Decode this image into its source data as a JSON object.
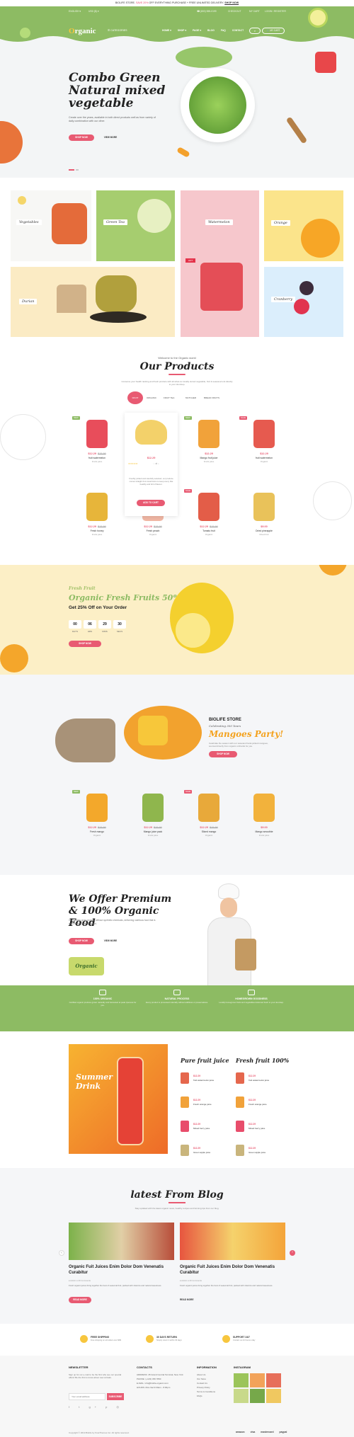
{
  "topbar": {
    "lead": "BIOLIFE STORE.",
    "highlight": "SAVE 20%",
    "mid": "OFF EVERYTHING PURCHASE + FREE UNLIMITED DELIVERY.",
    "cta": "SHOP NOW"
  },
  "header": {
    "left": [
      "ENGLISH ▾",
      "USD ($) ▾"
    ],
    "phone": "☎ (800) 555-0199",
    "right": [
      "CHECKOUT",
      "MY CART",
      "LOGIN / REGISTER"
    ],
    "logo_main": "rganic",
    "logo_o": "O",
    "categories": "☰  CATEGORIES",
    "nav": [
      "HOME ▾",
      "SHOP ▾",
      "PAGE ▾",
      "BLOG",
      "FAQ",
      "CONTACT"
    ],
    "cart": "MY CART"
  },
  "hero": {
    "title": "Combo Green Natural mixed vegetable",
    "desc": "Create over the years, available in both direct products well as from variety of daily combination with our other.",
    "btn1": "SHOP NOW",
    "btn2": "VIEW MORE"
  },
  "tiles": [
    "Vegetables",
    "Green Tea",
    "Watermelon",
    "Orange",
    "Durian",
    "Cranberry"
  ],
  "products": {
    "pre": "Welcome to the Organic world",
    "title": "Our Products",
    "desc": "Conserve your health ranking and fresh produce with all what our locally stored vegetable, fruit & seasonal unit directly to your doorstep.",
    "tabs": [
      "FRUIT",
      "ORGANIC",
      "FRUIT TEA",
      "MUTCHER",
      "BREAD FRUITS"
    ],
    "items": [
      {
        "price": "$12.29",
        "old": "$15.99",
        "name": "fruit watermelon",
        "cat": "Fruits juice",
        "badge": "NEW",
        "color": "#e84d5b"
      },
      {
        "price": "$12.29",
        "old": "",
        "name": "Fresh banana",
        "cat": "Organic",
        "badge": "",
        "color": "#f3d16a"
      },
      {
        "price": "$12.29",
        "old": "",
        "name": "Mango fruit juice",
        "cat": "Fruits juice",
        "badge": "NEW",
        "color": "#f1a23a"
      },
      {
        "price": "$12.29",
        "old": "",
        "name": "fruit watermelon",
        "cat": "Organic",
        "badge": "SALE",
        "color": "#e65a4f"
      },
      {
        "price": "$12.29",
        "old": "$15.99",
        "name": "Fresh honey",
        "cat": "Fruits juice",
        "badge": "",
        "color": "#e7b53a"
      },
      {
        "price": "$12.29",
        "old": "$15.99",
        "name": "Fresh peach",
        "cat": "Organic",
        "badge": "",
        "color": "#f1b7a4"
      },
      {
        "price": "$12.29",
        "old": "$15.99",
        "name": "Tomato fruit",
        "cat": "Organic",
        "badge": "SALE",
        "color": "#e35d48"
      },
      {
        "price": "$9.00",
        "old": "",
        "name": "Dried pineapple",
        "cat": "Dried fruit",
        "badge": "",
        "color": "#e9c25a"
      }
    ],
    "featured": {
      "rating": "★★★★★",
      "desc": "Freshly picked and carefully selected, our produce comes straight from local farms to keep every bite healthy and full of flavour.",
      "btn": "ADD TO CART"
    }
  },
  "promo": {
    "pre": "Fresh Fruit",
    "title": "Organic Fresh Fruits 50% Off",
    "sub": "Get 25% Off on Your Order",
    "counts": [
      "00",
      "06",
      "29",
      "30"
    ],
    "labels": [
      "DAYS",
      "HRS",
      "MINS",
      "SECS"
    ],
    "btn": "SHOP NOW"
  },
  "mango": {
    "pre": "BIOLIFE STORE",
    "sub": "Celebrating 300 Years",
    "title": "Mangoes Party!",
    "desc": "Celebrate the season with our sweetest hand-picked mangoes, sourced directly from organic orchards for you.",
    "btn": "SHOP NOW",
    "items": [
      {
        "price": "$12.29",
        "old": "$15.99",
        "name": "Fresh mango",
        "cat": "Organic",
        "badge": "NEW",
        "color": "#f3a82b"
      },
      {
        "price": "$12.29",
        "old": "$15.99",
        "name": "Mango juice pack",
        "cat": "Fruits juice",
        "badge": "",
        "color": "#8fb64d"
      },
      {
        "price": "$12.29",
        "old": "$15.99",
        "name": "Sliced mango",
        "cat": "Organic",
        "badge": "SALE",
        "color": "#e8a93a"
      },
      {
        "price": "$9.00",
        "old": "",
        "name": "Mango smoothie",
        "cat": "Fruits juice",
        "badge": "",
        "color": "#f2b23c"
      }
    ]
  },
  "premium": {
    "title": "We Offer Premium & 100% Organic Food",
    "desc": "Our farmers grow produce without synthetic chemicals, delivering nutritious food that is good for you and the planet.",
    "btn1": "SHOP NOW",
    "btn2": "VIEW MORE",
    "tag": "Organic"
  },
  "features": [
    {
      "title": "100% ORGANIC",
      "desc": "Certified organic produce grown naturally and harvested at peak ripeness for you."
    },
    {
      "title": "NATURAL PROCESS",
      "desc": "Every product is processed naturally without additives or preservatives."
    },
    {
      "title": "HOMEGROWN GOODNESS",
      "desc": "Locally homegrown fruits and vegetables delivered fresh to your doorstep."
    }
  ],
  "juice": {
    "banner": "Summer Drink",
    "col1": "Pure fruit juice",
    "col2": "Fresh fruit 100%",
    "items": [
      {
        "price": "$12.29",
        "name": "fruit watermelon juice",
        "color": "#e5674d"
      },
      {
        "price": "$12.29",
        "name": "Fresh orange juice",
        "color": "#f1a23a"
      },
      {
        "price": "$12.29",
        "name": "Mixed berry juice",
        "color": "#e84d6b"
      },
      {
        "price": "$12.29",
        "name": "Green apple juice",
        "color": "#c9b57c"
      }
    ]
  },
  "blog": {
    "title": "latest From Blog",
    "desc": "Stay updated with the latest organic news, healthy recipes and farming tips from our blog.",
    "posts": [
      {
        "title": "Organic Fuit Juices Enim Dolor Dom Venenatis Curabitur",
        "meta": "● Admin  ● 20 Comments",
        "desc": "Fresh organic juices bring together the best of seasonal fruit, packed with vitamins and natural sweetness.",
        "btn": "READ MORE"
      },
      {
        "title": "Organic Fuit Juices Enim Dolor Dom Venenatis Curabitur",
        "meta": "● Admin  ● 20 Comments",
        "desc": "Fresh organic juices bring together the best of seasonal fruit, packed with vitamins and natural sweetness.",
        "btn": "READ MORE"
      }
    ]
  },
  "services": [
    {
      "title": "FREE SHIPPING",
      "desc": "Free shipping on all orders over $99"
    },
    {
      "title": "30 DAYS RETURN",
      "desc": "Simply return it within 30 days"
    },
    {
      "title": "SUPPORT 24/7",
      "desc": "Contact us 24 hours a day"
    }
  ],
  "footer": {
    "newsletter": "NEWSLETTER",
    "news_desc": "Sign up for our e-mail to be the first who see our special offers! Be the first to know about new arrivals.",
    "email_ph": "Your email address",
    "subscribe": "SUBSCRIBE",
    "contacts": "CONTACTS",
    "contact_lines": [
      "ADDRESS: 45 Grand Central Terminal, New York",
      "PHONE: (+123) 456 7890",
      "E-MAIL: info@biolife-organic.com",
      "HOURS: Mon-Sat 9:00am - 8:00pm"
    ],
    "info": "INFORMATION",
    "info_links": [
      "About Us",
      "Our Store",
      "Contact Us",
      "Privacy Policy",
      "Terms & Conditions",
      "FAQs"
    ],
    "instagram": "INSTAGRAM",
    "copyright": "Copyright © 2019 Biolife by KuteThemes Inc. All rights reserved.",
    "payments": [
      "amazon",
      "visa",
      "mastercard",
      "paypal"
    ]
  }
}
